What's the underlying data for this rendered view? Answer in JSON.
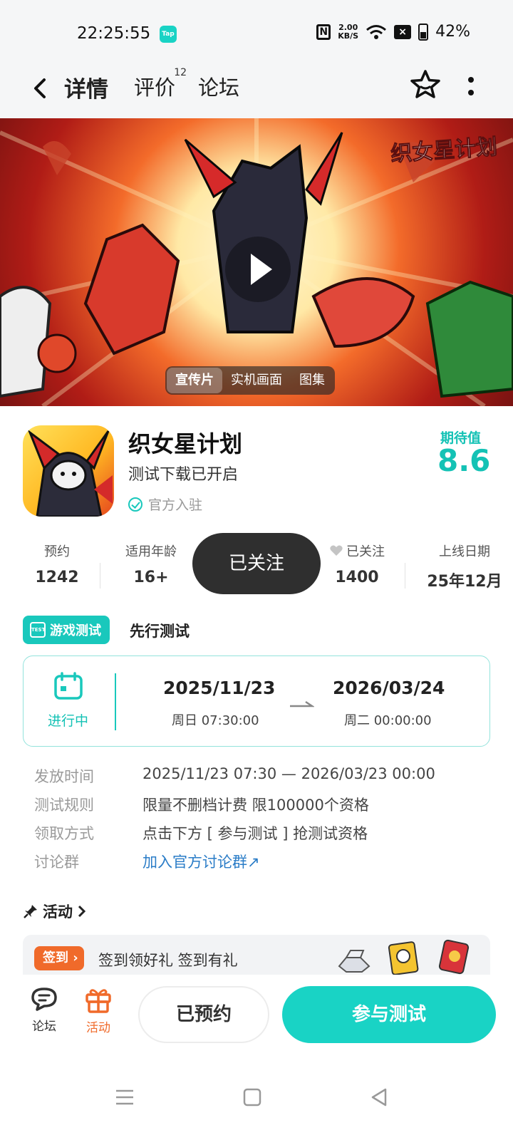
{
  "status": {
    "time": "22:25:55",
    "app_badge": "Tap",
    "speed_top": "2.00",
    "speed_bottom": "KB/S",
    "battery": "42%"
  },
  "header": {
    "tabs": [
      {
        "label": "详情",
        "active": true
      },
      {
        "label": "评价",
        "count": "12"
      },
      {
        "label": "论坛"
      }
    ]
  },
  "hero": {
    "logo_text": "织女星计划",
    "media_tabs": [
      "宣传片",
      "实机画面",
      "图集"
    ]
  },
  "game": {
    "title": "织女星计划",
    "subtitle": "测试下载已开启",
    "official": "官方入驻",
    "score_label": "期待值",
    "score": "8.6"
  },
  "stats": [
    {
      "label": "预约",
      "value": "1242"
    },
    {
      "label": "适用年龄",
      "value": "16+"
    },
    {
      "label": "已关注",
      "value": "1400"
    },
    {
      "label": "上线日期",
      "value": "25年12月"
    }
  ],
  "follow_button": "已关注",
  "test": {
    "badge": "游戏测试",
    "badge_icon_text": "TEST",
    "title": "先行测试",
    "state": "进行中",
    "start_date": "2025/11/23",
    "start_time": "周日  07:30:00",
    "end_date": "2026/03/24",
    "end_time": "周二  00:00:00"
  },
  "info": [
    {
      "key": "发放时间",
      "value": "2025/11/23 07:30 — 2026/03/23 00:00"
    },
    {
      "key": "测试规则",
      "value": "限量不删档计费 限100000个资格"
    },
    {
      "key": "领取方式",
      "value": "点击下方 [ 参与测试 ] 抢测试资格"
    },
    {
      "key": "讨论群",
      "value": "加入官方讨论群↗"
    }
  ],
  "activity": {
    "title": "活动",
    "sign_badge": "签到 ›",
    "sign_text": "签到领好礼 签到有礼"
  },
  "bottom": {
    "forum": "论坛",
    "activity": "活动",
    "reserved": "已预约",
    "join": "参与测试"
  },
  "colors": {
    "accent": "#19d3c5",
    "orange": "#f06a2a",
    "link": "#2a7cc7"
  }
}
